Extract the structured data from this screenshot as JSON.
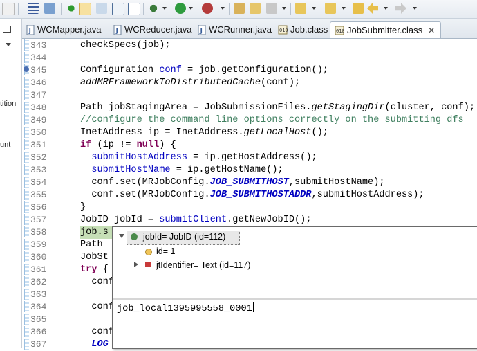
{
  "tabs": [
    {
      "label": "WCMapper.java",
      "icon": "java-file-icon",
      "active": false
    },
    {
      "label": "WCReducer.java",
      "icon": "java-file-icon",
      "active": false
    },
    {
      "label": "WCRunner.java",
      "icon": "java-file-icon",
      "active": false
    },
    {
      "label": "Job.class",
      "icon": "class-file-icon",
      "active": false
    },
    {
      "label": "JobSubmitter.class",
      "icon": "class-file-icon",
      "active": true
    }
  ],
  "tab_close_glyph": "✕",
  "left_panel": {
    "fragments": [
      "tition",
      "unt"
    ]
  },
  "lines": [
    {
      "num": "343",
      "segments": [
        {
          "t": "checkSpecs(job);",
          "c": ""
        }
      ]
    },
    {
      "num": "344",
      "segments": []
    },
    {
      "num": "345",
      "segments": [
        {
          "t": "Configuration ",
          "c": ""
        },
        {
          "t": "conf",
          "c": "fld"
        },
        {
          "t": " = job.getConfiguration();",
          "c": ""
        }
      ]
    },
    {
      "num": "346",
      "segments": [
        {
          "t": "addMRFrameworkToDistributedCache",
          "c": "ital"
        },
        {
          "t": "(conf);",
          "c": ""
        }
      ]
    },
    {
      "num": "347",
      "segments": []
    },
    {
      "num": "348",
      "segments": [
        {
          "t": "Path jobStagingArea = JobSubmissionFiles.",
          "c": ""
        },
        {
          "t": "getStagingDir",
          "c": "ital"
        },
        {
          "t": "(cluster, conf);",
          "c": ""
        }
      ]
    },
    {
      "num": "349",
      "segments": [
        {
          "t": "//configure the command line options correctly on the submitting dfs",
          "c": "cmt"
        }
      ]
    },
    {
      "num": "350",
      "segments": [
        {
          "t": "InetAddress ip = InetAddress.",
          "c": ""
        },
        {
          "t": "getLocalHost",
          "c": "ital"
        },
        {
          "t": "();",
          "c": ""
        }
      ]
    },
    {
      "num": "351",
      "segments": [
        {
          "t": "if",
          "c": "kw"
        },
        {
          "t": " (ip != ",
          "c": ""
        },
        {
          "t": "null",
          "c": "kw"
        },
        {
          "t": ") {",
          "c": ""
        }
      ]
    },
    {
      "num": "352",
      "segments": [
        {
          "t": "  ",
          "c": ""
        },
        {
          "t": "submitHostAddress",
          "c": "fld"
        },
        {
          "t": " = ip.getHostAddress();",
          "c": ""
        }
      ]
    },
    {
      "num": "353",
      "segments": [
        {
          "t": "  ",
          "c": ""
        },
        {
          "t": "submitHostName",
          "c": "fld"
        },
        {
          "t": " = ip.getHostName();",
          "c": ""
        }
      ]
    },
    {
      "num": "354",
      "segments": [
        {
          "t": "  conf.set(MRJobConfig.",
          "c": ""
        },
        {
          "t": "JOB_SUBMITHOST",
          "c": "cst"
        },
        {
          "t": ",submitHostName);",
          "c": ""
        }
      ]
    },
    {
      "num": "355",
      "segments": [
        {
          "t": "  conf.set(MRJobConfig.",
          "c": ""
        },
        {
          "t": "JOB_SUBMITHOSTADDR",
          "c": "cst"
        },
        {
          "t": ",submitHostAddress);",
          "c": ""
        }
      ]
    },
    {
      "num": "356",
      "segments": [
        {
          "t": "}",
          "c": ""
        }
      ]
    },
    {
      "num": "357",
      "segments": [
        {
          "t": "JobID jobId = ",
          "c": ""
        },
        {
          "t": "submitClient",
          "c": "fld"
        },
        {
          "t": ".getNewJobID();",
          "c": ""
        }
      ]
    },
    {
      "num": "358",
      "segments": [
        {
          "t": "job.s",
          "c": ""
        }
      ]
    },
    {
      "num": "359",
      "segments": [
        {
          "t": "Path ",
          "c": ""
        }
      ]
    },
    {
      "num": "360",
      "segments": [
        {
          "t": "JobSt",
          "c": ""
        }
      ]
    },
    {
      "num": "361",
      "segments": [
        {
          "t": "try",
          "c": "kw"
        },
        {
          "t": " {",
          "c": ""
        }
      ]
    },
    {
      "num": "362",
      "segments": [
        {
          "t": "  conf",
          "c": ""
        }
      ]
    },
    {
      "num": "363",
      "segments": []
    },
    {
      "num": "364",
      "segments": [
        {
          "t": "  conf",
          "c": ""
        }
      ]
    },
    {
      "num": "365",
      "segments": []
    },
    {
      "num": "366",
      "segments": [
        {
          "t": "  conf",
          "c": ""
        }
      ]
    },
    {
      "num": "367",
      "segments": [
        {
          "t": "  LOG",
          "c": "cst"
        }
      ]
    }
  ],
  "inspect_popup": {
    "rows": [
      {
        "label": "jobId= JobID  (id=112)",
        "icon": "variable-icon"
      },
      {
        "label": "id= 1",
        "icon": "field-icon"
      },
      {
        "label": "jtIdentifier= Text  (id=117)",
        "icon": "final-field-icon"
      }
    ],
    "value": "job_local1395995558_0001"
  },
  "colors": {
    "keyword": "#7f0055",
    "field": "#0000c0",
    "comment": "#3f7f5f",
    "highlight": "#c6dfb6",
    "annotation_arrow": "#e53a3a"
  }
}
